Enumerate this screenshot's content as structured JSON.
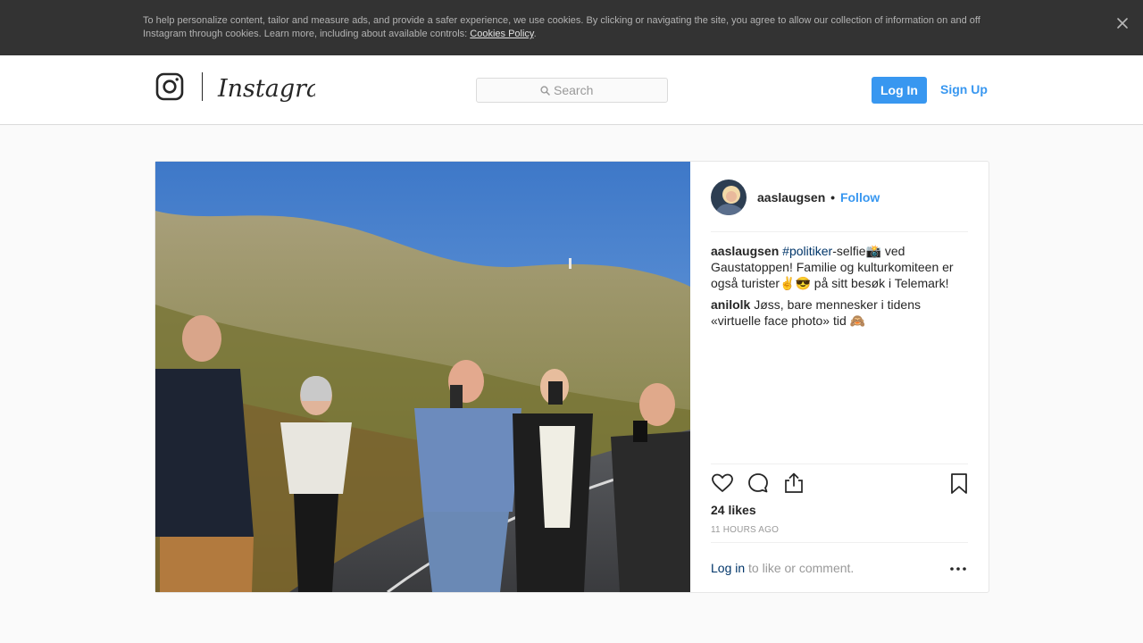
{
  "cookie_banner": {
    "text": "To help personalize content, tailor and measure ads, and provide a safer experience, we use cookies. By clicking or navigating the site, you agree to allow our collection of information on and off Instagram through cookies. Learn more, including about available controls: ",
    "link": "Cookies Policy",
    "period": ".",
    "close_icon": "close-icon"
  },
  "header": {
    "logo_wordmark": "Instagram",
    "search_placeholder": "Search",
    "login_label": "Log In",
    "signup_label": "Sign Up"
  },
  "post": {
    "author": "aaslaugsen",
    "separator": "•",
    "follow_label": "Follow",
    "caption": {
      "user": "aaslaugsen",
      "hashtag": "#politiker",
      "text": "-selfie📸 ved Gaustatoppen! Familie og kulturkomiteen er også turister✌😎 på sitt besøk i Telemark!"
    },
    "comments": [
      {
        "user": "anilolk",
        "text": "Jøss, bare mennesker i tidens «virtuelle face photo» tid 🙈"
      }
    ],
    "likes": "24 likes",
    "time": "11 HOURS AGO",
    "login_link": "Log in",
    "login_suffix": " to like or comment.",
    "icons": [
      "heart-icon",
      "comment-icon",
      "share-icon",
      "bookmark-icon",
      "more-options-icon"
    ]
  },
  "colors": {
    "accent": "#3897f0",
    "link_dark": "#003569",
    "cookie_bg": "#333333",
    "page_bg": "#fafafa",
    "text": "#262626",
    "muted": "#999999"
  }
}
